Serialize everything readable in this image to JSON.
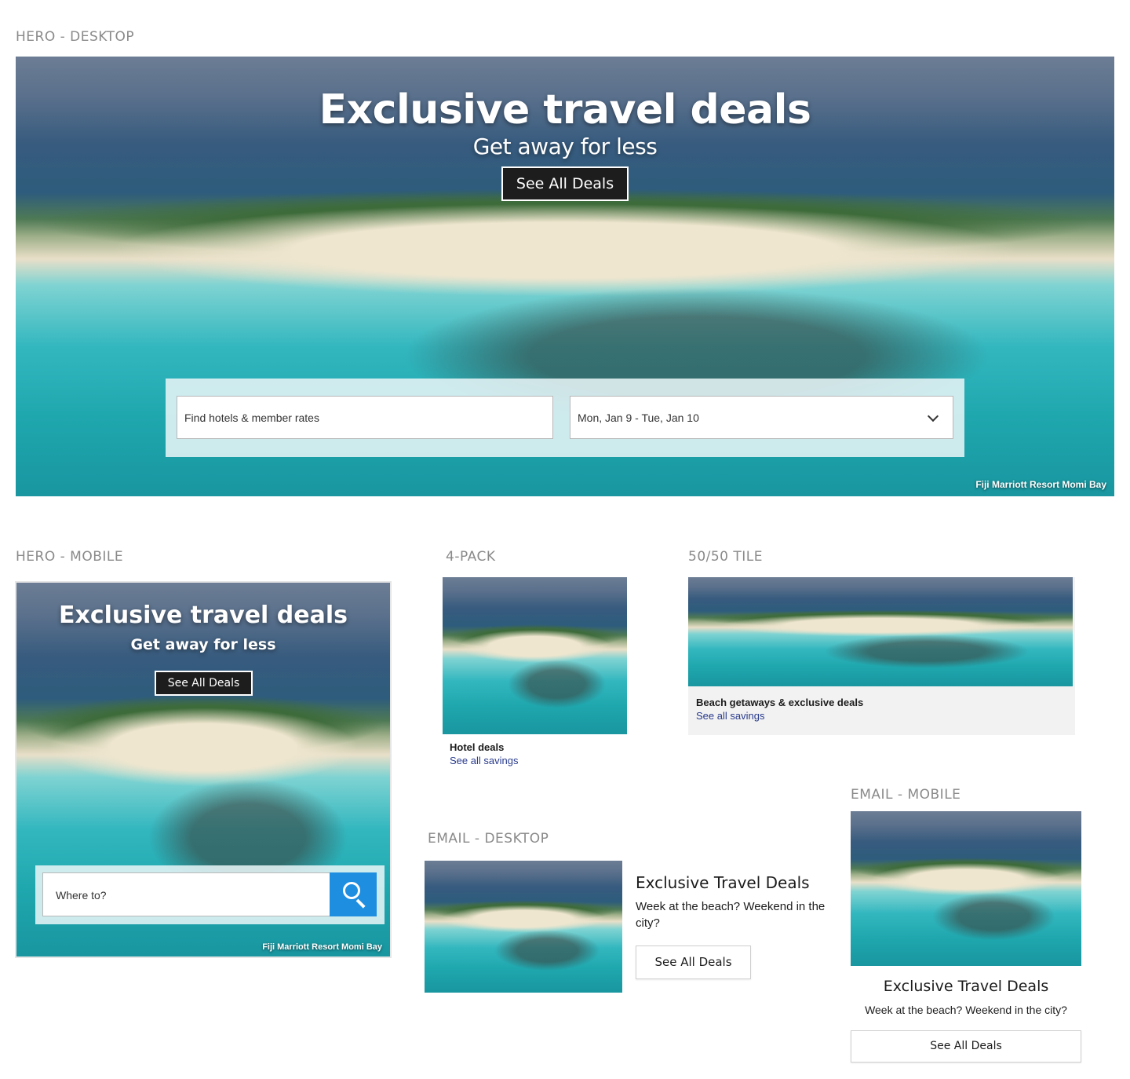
{
  "sections": {
    "hero_desktop": "HERO - DESKTOP",
    "hero_mobile": "HERO - MOBILE",
    "four_pack": "4-PACK",
    "fifty_fifty": "50/50 TILE",
    "email_desktop": "EMAIL - DESKTOP",
    "email_mobile": "EMAIL - MOBILE"
  },
  "hero_desktop": {
    "title": "Exclusive travel deals",
    "subtitle": "Get away for less",
    "cta": "See All Deals",
    "hotels_placeholder": "Find hotels & member rates",
    "dates_value": "Mon, Jan 9 - Tue, Jan 10",
    "caption": "Fiji Marriott Resort Momi Bay"
  },
  "hero_mobile": {
    "title": "Exclusive travel deals",
    "subtitle": "Get away for less",
    "cta": "See All Deals",
    "where_placeholder": "Where to?",
    "caption": "Fiji Marriott Resort Momi Bay"
  },
  "four_pack": {
    "title": "Hotel deals",
    "link": "See all savings"
  },
  "fifty_fifty": {
    "title": "Beach getaways & exclusive deals",
    "link": "See all savings"
  },
  "email_desktop": {
    "title": "Exclusive Travel Deals",
    "body": "Week at the beach? Weekend in the city?",
    "cta": "See All Deals"
  },
  "email_mobile": {
    "title": "Exclusive Travel Deals",
    "body": "Week at the beach? Weekend in the city?",
    "cta": "See All Deals"
  },
  "colors": {
    "accent": "#1e8ee0",
    "link": "#283a8c",
    "button_dark": "#1d1d1d"
  },
  "icons": {
    "search": "search-icon",
    "dropdown": "chevron-down-icon"
  }
}
